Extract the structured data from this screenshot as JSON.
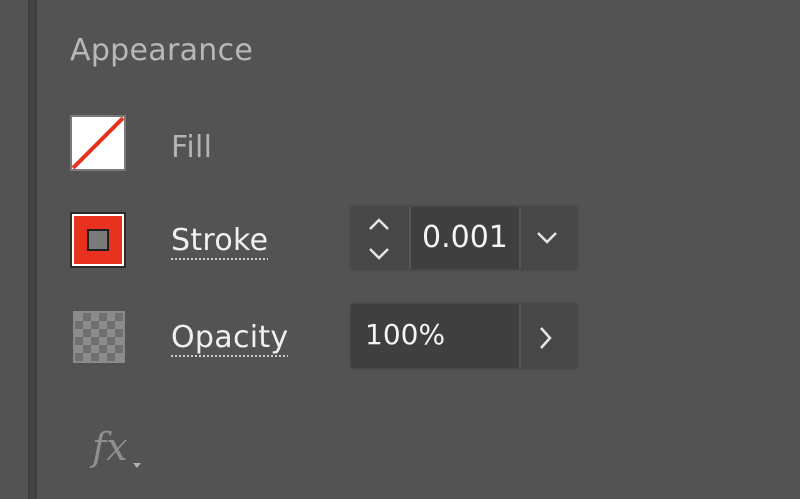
{
  "panel": {
    "title": "Appearance"
  },
  "fill": {
    "label": "Fill",
    "icon": "fill-none-swatch-icon",
    "color": "#ffffff",
    "slash_color": "#e8321f"
  },
  "stroke": {
    "label": "Stroke",
    "icon": "stroke-swatch-icon",
    "color": "#e8321f",
    "weight_value": "0.001",
    "spinner_icon": "up-down-chevrons-icon",
    "dropdown_icon": "chevron-down-icon"
  },
  "opacity": {
    "label": "Opacity",
    "icon": "opacity-checker-icon",
    "value": "100%",
    "arrow_icon": "chevron-right-icon"
  },
  "effects": {
    "label": "fx",
    "icon": "fx-effects-icon"
  }
}
